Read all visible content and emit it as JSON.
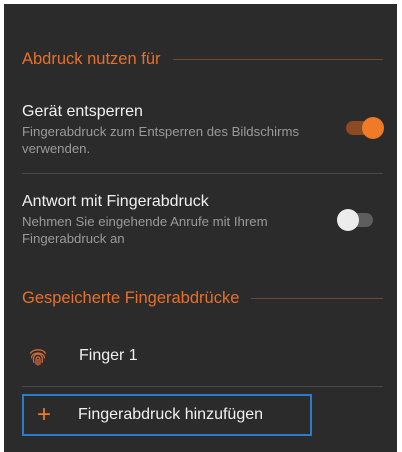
{
  "sections": {
    "use_for": {
      "title": "Abdruck nutzen für",
      "items": [
        {
          "title": "Gerät entsperren",
          "subtitle": "Fingerabdruck zum Entsperren des Bildschirms verwenden.",
          "toggle_state": "on"
        },
        {
          "title": "Antwort mit Fingerabdruck",
          "subtitle": "Nehmen Sie eingehende Anrufe mit Ihrem Fingerabdruck an",
          "toggle_state": "off"
        }
      ]
    },
    "saved": {
      "title": "Gespeicherte Fingerabdrücke",
      "fingerprints": [
        {
          "label": "Finger 1",
          "icon": "fingerprint-icon"
        }
      ],
      "add_action": {
        "label": "Fingerabdruck hinzufügen",
        "icon": "plus-icon"
      }
    }
  },
  "colors": {
    "background": "#2b2b2b",
    "accent": "#ef7a28",
    "focus_outline": "#2a7cc9",
    "toggle_off_thumb": "#ececec"
  }
}
